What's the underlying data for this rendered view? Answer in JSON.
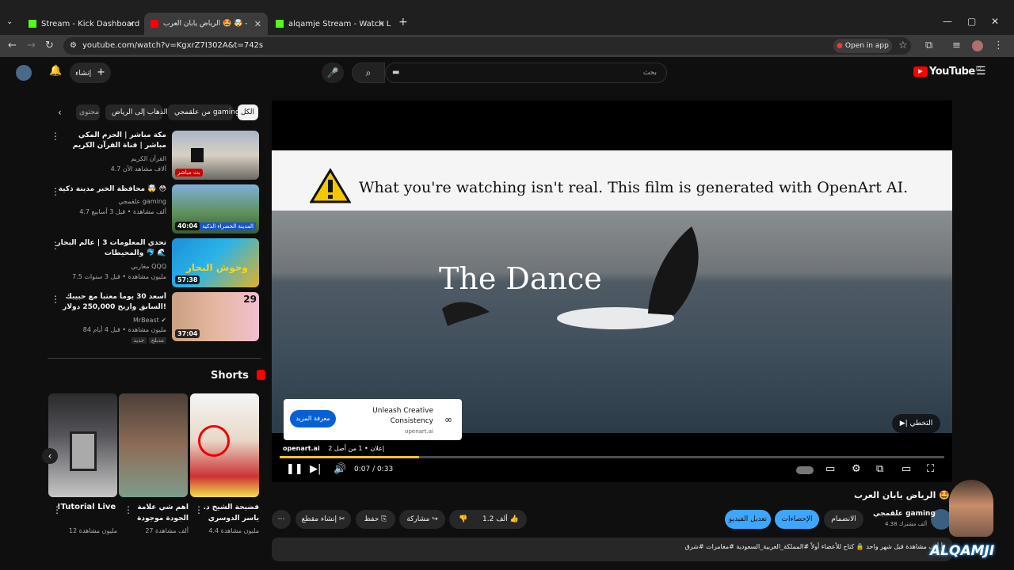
{
  "browser": {
    "tabs": [
      {
        "title": "Stream - Kick Dashboard"
      },
      {
        "title": "الرياض يابان العرب 🤩 🤯 -"
      },
      {
        "title": "alqamje Stream - Watch Live o"
      }
    ],
    "url": "youtube.com/watch?v=KgxrZ7I302A&t=742s",
    "open_in_app": "Open in app"
  },
  "youtube": {
    "logo_text": "YouTube",
    "logo_region": "JO",
    "search_placeholder": "بحث",
    "create_label": "إنشاء"
  },
  "chips": [
    {
      "label": "الكل"
    },
    {
      "label": "من علقمجي gaming"
    },
    {
      "label": "الذهاب إلى الرياض"
    },
    {
      "label": "محتوى"
    }
  ],
  "related": [
    {
      "title": "مكة مباشر | الحرم المكي مباشر | قناة القرآن الكريم السعودية | Makkah Live 🕋",
      "channel": "القرآن الكريم",
      "meta": "4.7 آلاف مشاهد الآن",
      "badge": "بث مباشر"
    },
    {
      "title": "محافظة الخبر مدينة ذكية 🤯 😳",
      "channel": "علقمجي gaming",
      "meta": "4.7 ألف مشاهدة • قبل 3 أسابيع",
      "duration": "40:04",
      "overlay": "المدينة الخضراء الذكية"
    },
    {
      "title": "تحدي المعلومات 3 | عالم البحار والمحيطات 🐬 🌊",
      "channel": "مغاربي QQQ",
      "meta": "7.5 مليون مشاهدة • قبل 3 سنوات",
      "duration": "57:38",
      "overlay": "وحوش البحار"
    },
    {
      "title": "أسعد 30 يوماً معتباً مع حبيبك السابق واربح 250,000 دولار!",
      "channel": "MrBeast",
      "meta": "84 مليون مشاهدة • قبل 4 أيام",
      "duration": "37:04",
      "tags": [
        "جديد",
        "مدبلج"
      ],
      "day": "29"
    }
  ],
  "shorts": {
    "heading": "Shorts",
    "items": [
      {
        "title": "!Tutorial Live 🔥New",
        "views": "12 مليون مشاهدة"
      },
      {
        "title": "اهم شي علامة الجودة موجودة",
        "views": "27 ألف مشاهدة"
      },
      {
        "title": "فضيحة الشيخ د. ياسر الدوسري",
        "views": "4.4 مليون مشاهدة"
      }
    ]
  },
  "player": {
    "warning": "What you're watching isn't real. This film is generated with OpenArt AI.",
    "film_title": "The Dance",
    "ad_card": {
      "title": "Unleash Creative Consistency",
      "domain": "openart.ai",
      "cta": "معرفة المزيد"
    },
    "skip_label": "التخطي",
    "ad_info": "إعلان • 1 من أصل 2",
    "ad_domain": "openart.ai",
    "time": "0:07 / 0:33",
    "progress": 0.21
  },
  "video": {
    "title": "الرياض يابان العرب 🤩 🤯",
    "channel": "علقمجي gaming",
    "subscribers": "4.38 ألف مشترك",
    "join": "الانضمام",
    "stats": "الإحصاءات",
    "edit": "تعديل الفيديو",
    "likes": "1.2 ألف",
    "share": "مشاركة",
    "save": "حفظ",
    "clip": "إنشاء مقطع",
    "description": "أ ألف مشاهدة قبل شهر واحد 🔒 كتاح للأعضاء أولاً #المملكة_العربية_السعودية #مغامرات #شرق"
  },
  "watermark": "ALQAMJI"
}
